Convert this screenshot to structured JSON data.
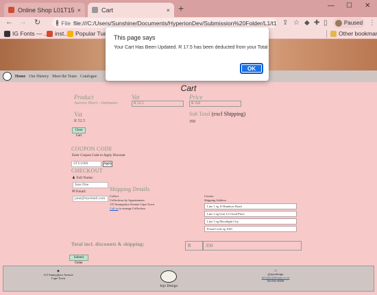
{
  "browser": {
    "tabs": [
      {
        "title": "Online Shop L01T15",
        "close": "×"
      },
      {
        "title": "Cart",
        "close": "×"
      }
    ],
    "new_tab": "+",
    "window_controls": {
      "minimize": "—",
      "maximize": "☐",
      "close": "✕"
    },
    "nav": {
      "back": "←",
      "forward": "→",
      "reload": "↻"
    },
    "address": {
      "scheme_label": "File",
      "url": "file:///C:/Users/Sunshine/Documents/HyperionDev/Submission%20Folder/L1/t15_CAPI..."
    },
    "profile_label": "Paused",
    "bookmarks": [
      {
        "label": "IG Fonts — ...",
        "color": "#333333"
      },
      {
        "label": "inst...",
        "color": "#d24a2f"
      },
      {
        "label": "Popular Tuesday Ha...",
        "color": "#f4b400"
      }
    ],
    "other_bookmarks": "Other bookmarks"
  },
  "site_nav": {
    "links": [
      "Home",
      "Our History",
      "Meet the Team",
      "Catalogue"
    ]
  },
  "cart": {
    "title": "Cart",
    "product_label": "Product",
    "product_value": "Aurora Short - Intimates",
    "vat_label": "Vat",
    "vat_value": "R 52.5",
    "price_label": "Price",
    "price_value": "R 350",
    "vat2_label": "Vat",
    "vat2_value": "R 52.5",
    "subtotal_label": "Sub Total",
    "subtotal_suffix": "(excl Shipping)",
    "subtotal_value": "350",
    "clear_cart": "Clear Cart"
  },
  "coupon": {
    "heading": "COUPON CODE",
    "hint": "Enter Coupon Code to Apply Discount",
    "input_value": "STU1000",
    "apply_label": "Apply"
  },
  "checkout": {
    "heading": "CHECKOUT",
    "full_name_label": "Full Name:",
    "full_name_value": "Jane Doe",
    "email_label": "Email:",
    "email_value": "jane@myemail.com"
  },
  "shipping": {
    "heading": "Shipping Details",
    "collect_title": "Collect",
    "collect_line1": "Collections by Appointment",
    "collect_line2": "115 Sunnyplace Avenue Cape Town",
    "collect_link": "Call us",
    "collect_line3": "to arrange Collection",
    "courier_title": "Courier",
    "courier_sub": "Shipping Address",
    "address_lines": [
      "Line 1 eg 10 Rainbow Road",
      "Line 2 eg Unit 13 Cloud Place",
      "Line 3 eg Moonlight City",
      "Postal Code eg 1001"
    ]
  },
  "totals": {
    "label": "Total incl. discounts & shipping:",
    "currency": "R",
    "value": "350",
    "submit_label": "Submit Order"
  },
  "footer": {
    "address_line1": "115 Sunnyplace Avenue",
    "address_line2": "Cape Town",
    "brand": "Jojo Design",
    "handle": "@jojodesign",
    "email": "info@jojodesign.co.za",
    "phone": "021553-8590"
  },
  "alert": {
    "title": "This page says",
    "message": "Your Cart Has Been Updated. R 17.5 has been deducted from your Total",
    "ok_label": "OK"
  }
}
